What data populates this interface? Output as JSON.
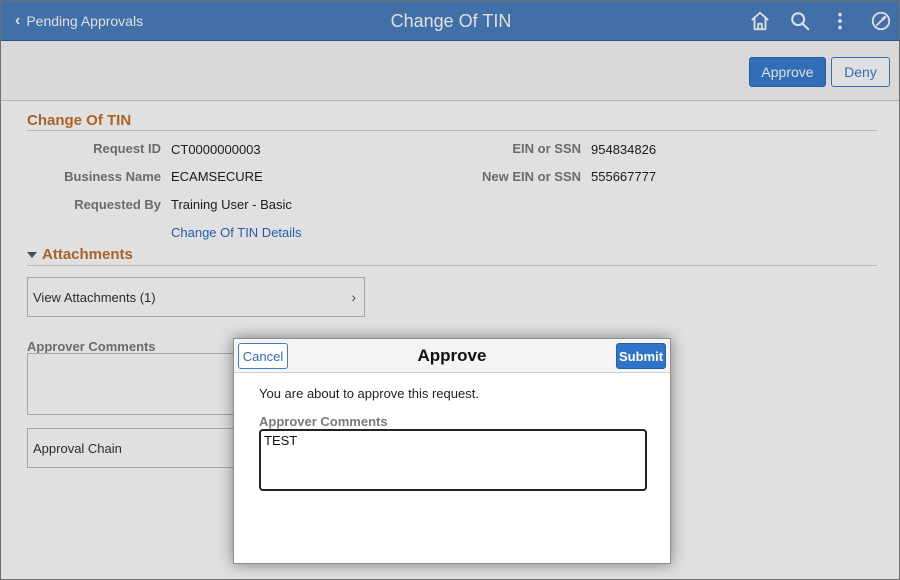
{
  "header": {
    "back_label": "Pending Approvals",
    "title": "Change Of TIN",
    "icons": [
      "home-icon",
      "search-icon",
      "more-vertical-icon",
      "navigation-compass-icon"
    ]
  },
  "toolbar": {
    "approve_label": "Approve",
    "deny_label": "Deny"
  },
  "details": {
    "section_title": "Change Of TIN",
    "fields": [
      {
        "label": "Request ID",
        "value": "CT0000000003"
      },
      {
        "label": "Business Name",
        "value": "ECAMSECURE"
      },
      {
        "label": "Requested By",
        "value": "Training User - Basic"
      },
      {
        "label": "EIN or SSN",
        "value": "954834826"
      },
      {
        "label": "New EIN or SSN",
        "value": "555667777"
      }
    ],
    "details_link": "Change Of TIN Details"
  },
  "attachments": {
    "title": "Attachments",
    "view_label": "View Attachments (1)"
  },
  "approver_comments": {
    "label": "Approver Comments"
  },
  "approval_chain": {
    "label": "Approval Chain"
  },
  "modal": {
    "cancel_label": "Cancel",
    "title": "Approve",
    "submit_label": "Submit",
    "message": "You are about to approve this request.",
    "comments_label": "Approver Comments",
    "comments_value": "TEST"
  },
  "colors": {
    "header_bg": "#4a7fbf",
    "accent_blue": "#3a7ed0",
    "section_orange": "#c0712e"
  }
}
